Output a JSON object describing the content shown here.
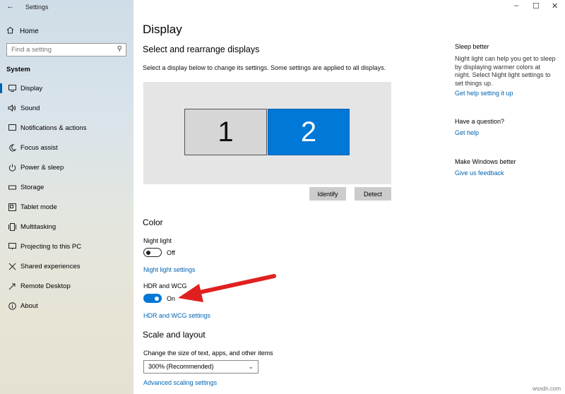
{
  "window": {
    "title": "Settings",
    "minimize": "–",
    "maximize": "☐",
    "close": "✕"
  },
  "sidebar": {
    "home_label": "Home",
    "search_placeholder": "Find a setting",
    "section": "System",
    "items": [
      {
        "label": "Display",
        "icon": "monitor-icon",
        "active": true
      },
      {
        "label": "Sound",
        "icon": "speaker-icon"
      },
      {
        "label": "Notifications & actions",
        "icon": "notifications-icon"
      },
      {
        "label": "Focus assist",
        "icon": "moon-icon"
      },
      {
        "label": "Power & sleep",
        "icon": "power-icon"
      },
      {
        "label": "Storage",
        "icon": "storage-icon"
      },
      {
        "label": "Tablet mode",
        "icon": "tablet-icon"
      },
      {
        "label": "Multitasking",
        "icon": "multitasking-icon"
      },
      {
        "label": "Projecting to this PC",
        "icon": "projecting-icon"
      },
      {
        "label": "Shared experiences",
        "icon": "shared-icon"
      },
      {
        "label": "Remote Desktop",
        "icon": "remote-icon"
      },
      {
        "label": "About",
        "icon": "info-icon"
      }
    ]
  },
  "main": {
    "title": "Display",
    "arrange_heading": "Select and rearrange displays",
    "arrange_desc": "Select a display below to change its settings. Some settings are applied to all displays.",
    "monitors": [
      "1",
      "2"
    ],
    "identify_label": "Identify",
    "detect_label": "Detect",
    "color_heading": "Color",
    "night_light_label": "Night light",
    "night_light_state": "Off",
    "night_light_settings_link": "Night light settings",
    "hdr_label": "HDR and WCG",
    "hdr_state": "On",
    "hdr_settings_link": "HDR and WCG settings",
    "scale_heading": "Scale and layout",
    "scale_desc": "Change the size of text, apps, and other items",
    "scale_value": "300% (Recommended)",
    "advanced_scaling_link": "Advanced scaling settings"
  },
  "right": {
    "sleep_heading": "Sleep better",
    "sleep_text": "Night light can help you get to sleep by displaying warmer colors at night. Select Night light settings to set things up.",
    "sleep_link": "Get help setting it up",
    "question_heading": "Have a question?",
    "question_link": "Get help",
    "better_heading": "Make Windows better",
    "better_link": "Give us feedback"
  },
  "watermark": "wsxdn.com",
  "colors": {
    "accent": "#0078d7",
    "link": "#0063b1",
    "arrow": "#e02020"
  }
}
